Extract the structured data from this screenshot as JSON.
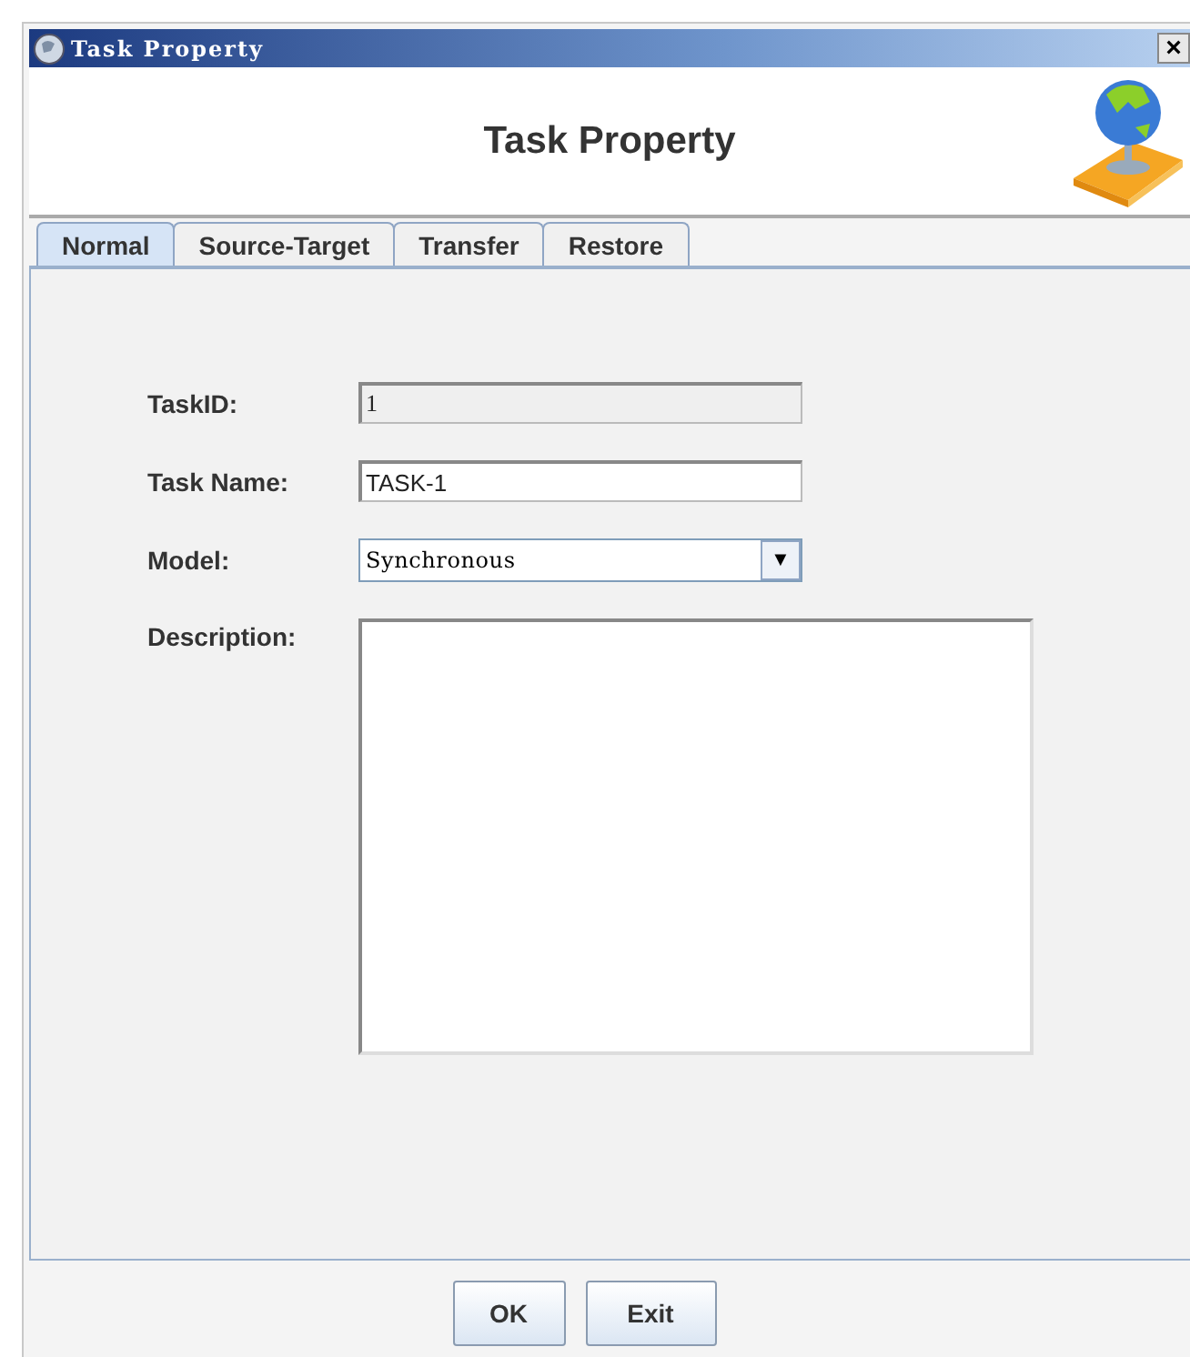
{
  "window": {
    "title": "Task Property",
    "close_glyph": "×"
  },
  "header": {
    "title": "Task Property"
  },
  "tabs": [
    {
      "label": "Normal",
      "selected": true
    },
    {
      "label": "Source-Target",
      "selected": false
    },
    {
      "label": "Transfer",
      "selected": false
    },
    {
      "label": "Restore",
      "selected": false
    }
  ],
  "fields": [
    {
      "kind": "text",
      "label": "TaskID:",
      "value": "1",
      "disabled": true
    },
    {
      "kind": "text",
      "label": "Task Name:",
      "value": "TASK-1",
      "disabled": false
    },
    {
      "kind": "select",
      "label": "Model:",
      "value": "Synchronous",
      "arrow": "▼"
    },
    {
      "kind": "textarea",
      "label": "Description:"
    }
  ],
  "buttons": [
    "OK",
    "Exit"
  ]
}
